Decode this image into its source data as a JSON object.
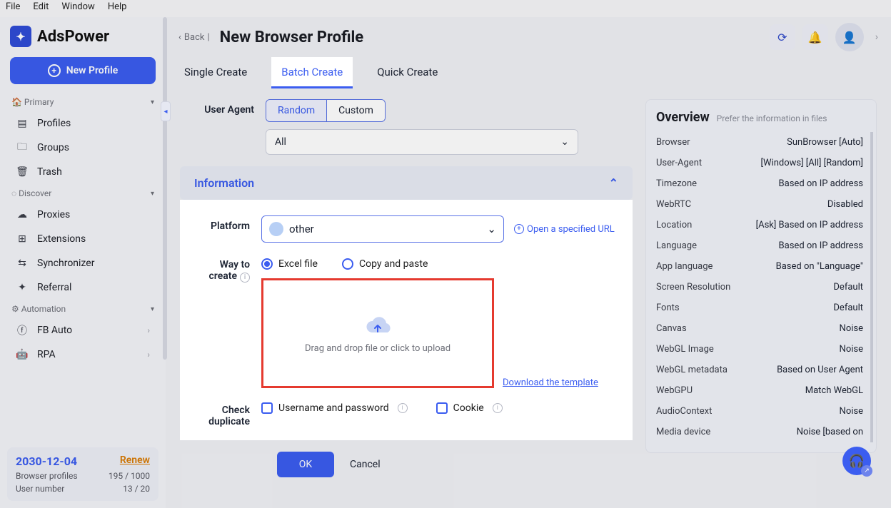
{
  "os_menu": [
    "File",
    "Edit",
    "Window",
    "Help"
  ],
  "brand": "AdsPower",
  "new_profile_btn": "New Profile",
  "sections": {
    "primary": {
      "title": "Primary",
      "items": [
        "Profiles",
        "Groups",
        "Trash"
      ]
    },
    "discover": {
      "title": "Discover",
      "items": [
        "Proxies",
        "Extensions",
        "Synchronizer",
        "Referral"
      ]
    },
    "automation": {
      "title": "Automation",
      "items": [
        "FB Auto",
        "RPA"
      ]
    }
  },
  "plan": {
    "date": "2030-12-04",
    "renew": "Renew",
    "rows": [
      {
        "k": "Browser profiles",
        "v": "195 / 1000"
      },
      {
        "k": "User number",
        "v": "13 / 20"
      }
    ]
  },
  "header": {
    "back": "Back",
    "title": "New Browser Profile"
  },
  "tabs": [
    "Single Create",
    "Batch Create",
    "Quick Create"
  ],
  "ua": {
    "label": "User Agent",
    "seg": [
      "Random",
      "Custom"
    ],
    "select": "All"
  },
  "accordion": "Information",
  "platform": {
    "label": "Platform",
    "value": "other",
    "open_url": "Open a specified URL"
  },
  "way": {
    "label": "Way to create",
    "opts": [
      "Excel file",
      "Copy and paste"
    ],
    "drop": "Drag and drop file or click to upload",
    "download": "Download the template"
  },
  "dup": {
    "label": "Check duplicate",
    "opts": [
      "Username and password",
      "Cookie"
    ]
  },
  "buttons": {
    "ok": "OK",
    "cancel": "Cancel"
  },
  "overview": {
    "title": "Overview",
    "sub": "Prefer the information in files",
    "rows": [
      {
        "k": "Browser",
        "v": "SunBrowser [Auto]"
      },
      {
        "k": "User-Agent",
        "v": "[Windows] [All] [Random]"
      },
      {
        "k": "Timezone",
        "v": "Based on IP address"
      },
      {
        "k": "WebRTC",
        "v": "Disabled"
      },
      {
        "k": "Location",
        "v": "[Ask] Based on IP address"
      },
      {
        "k": "Language",
        "v": "Based on IP address"
      },
      {
        "k": "App language",
        "v": "Based on \"Language\""
      },
      {
        "k": "Screen Resolution",
        "v": "Default"
      },
      {
        "k": "Fonts",
        "v": "Default"
      },
      {
        "k": "Canvas",
        "v": "Noise"
      },
      {
        "k": "WebGL Image",
        "v": "Noise"
      },
      {
        "k": "WebGL metadata",
        "v": "Based on User Agent"
      },
      {
        "k": "WebGPU",
        "v": "Match WebGL"
      },
      {
        "k": "AudioContext",
        "v": "Noise"
      },
      {
        "k": "Media device",
        "v": "Noise [based on"
      }
    ]
  }
}
